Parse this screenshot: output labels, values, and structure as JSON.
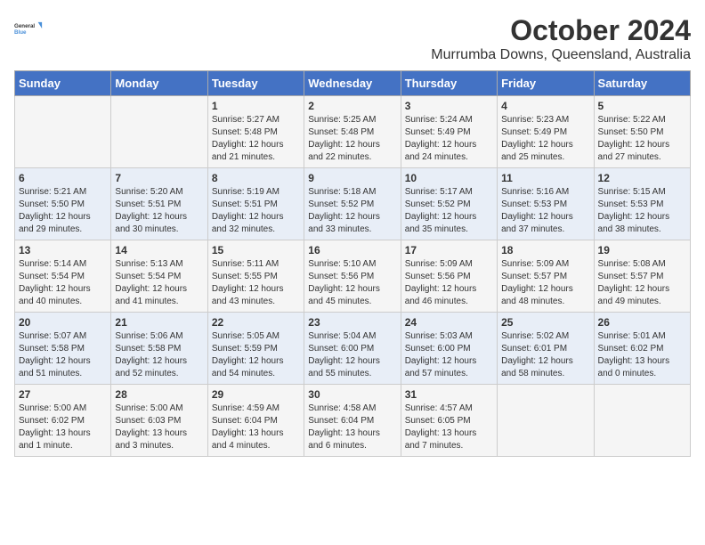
{
  "logo": {
    "line1": "General",
    "line2": "Blue"
  },
  "title": "October 2024",
  "location": "Murrumba Downs, Queensland, Australia",
  "days_of_week": [
    "Sunday",
    "Monday",
    "Tuesday",
    "Wednesday",
    "Thursday",
    "Friday",
    "Saturday"
  ],
  "weeks": [
    [
      {
        "day": "",
        "sunrise": "",
        "sunset": "",
        "daylight": ""
      },
      {
        "day": "",
        "sunrise": "",
        "sunset": "",
        "daylight": ""
      },
      {
        "day": "1",
        "sunrise": "Sunrise: 5:27 AM",
        "sunset": "Sunset: 5:48 PM",
        "daylight": "Daylight: 12 hours and 21 minutes."
      },
      {
        "day": "2",
        "sunrise": "Sunrise: 5:25 AM",
        "sunset": "Sunset: 5:48 PM",
        "daylight": "Daylight: 12 hours and 22 minutes."
      },
      {
        "day": "3",
        "sunrise": "Sunrise: 5:24 AM",
        "sunset": "Sunset: 5:49 PM",
        "daylight": "Daylight: 12 hours and 24 minutes."
      },
      {
        "day": "4",
        "sunrise": "Sunrise: 5:23 AM",
        "sunset": "Sunset: 5:49 PM",
        "daylight": "Daylight: 12 hours and 25 minutes."
      },
      {
        "day": "5",
        "sunrise": "Sunrise: 5:22 AM",
        "sunset": "Sunset: 5:50 PM",
        "daylight": "Daylight: 12 hours and 27 minutes."
      }
    ],
    [
      {
        "day": "6",
        "sunrise": "Sunrise: 5:21 AM",
        "sunset": "Sunset: 5:50 PM",
        "daylight": "Daylight: 12 hours and 29 minutes."
      },
      {
        "day": "7",
        "sunrise": "Sunrise: 5:20 AM",
        "sunset": "Sunset: 5:51 PM",
        "daylight": "Daylight: 12 hours and 30 minutes."
      },
      {
        "day": "8",
        "sunrise": "Sunrise: 5:19 AM",
        "sunset": "Sunset: 5:51 PM",
        "daylight": "Daylight: 12 hours and 32 minutes."
      },
      {
        "day": "9",
        "sunrise": "Sunrise: 5:18 AM",
        "sunset": "Sunset: 5:52 PM",
        "daylight": "Daylight: 12 hours and 33 minutes."
      },
      {
        "day": "10",
        "sunrise": "Sunrise: 5:17 AM",
        "sunset": "Sunset: 5:52 PM",
        "daylight": "Daylight: 12 hours and 35 minutes."
      },
      {
        "day": "11",
        "sunrise": "Sunrise: 5:16 AM",
        "sunset": "Sunset: 5:53 PM",
        "daylight": "Daylight: 12 hours and 37 minutes."
      },
      {
        "day": "12",
        "sunrise": "Sunrise: 5:15 AM",
        "sunset": "Sunset: 5:53 PM",
        "daylight": "Daylight: 12 hours and 38 minutes."
      }
    ],
    [
      {
        "day": "13",
        "sunrise": "Sunrise: 5:14 AM",
        "sunset": "Sunset: 5:54 PM",
        "daylight": "Daylight: 12 hours and 40 minutes."
      },
      {
        "day": "14",
        "sunrise": "Sunrise: 5:13 AM",
        "sunset": "Sunset: 5:54 PM",
        "daylight": "Daylight: 12 hours and 41 minutes."
      },
      {
        "day": "15",
        "sunrise": "Sunrise: 5:11 AM",
        "sunset": "Sunset: 5:55 PM",
        "daylight": "Daylight: 12 hours and 43 minutes."
      },
      {
        "day": "16",
        "sunrise": "Sunrise: 5:10 AM",
        "sunset": "Sunset: 5:56 PM",
        "daylight": "Daylight: 12 hours and 45 minutes."
      },
      {
        "day": "17",
        "sunrise": "Sunrise: 5:09 AM",
        "sunset": "Sunset: 5:56 PM",
        "daylight": "Daylight: 12 hours and 46 minutes."
      },
      {
        "day": "18",
        "sunrise": "Sunrise: 5:09 AM",
        "sunset": "Sunset: 5:57 PM",
        "daylight": "Daylight: 12 hours and 48 minutes."
      },
      {
        "day": "19",
        "sunrise": "Sunrise: 5:08 AM",
        "sunset": "Sunset: 5:57 PM",
        "daylight": "Daylight: 12 hours and 49 minutes."
      }
    ],
    [
      {
        "day": "20",
        "sunrise": "Sunrise: 5:07 AM",
        "sunset": "Sunset: 5:58 PM",
        "daylight": "Daylight: 12 hours and 51 minutes."
      },
      {
        "day": "21",
        "sunrise": "Sunrise: 5:06 AM",
        "sunset": "Sunset: 5:58 PM",
        "daylight": "Daylight: 12 hours and 52 minutes."
      },
      {
        "day": "22",
        "sunrise": "Sunrise: 5:05 AM",
        "sunset": "Sunset: 5:59 PM",
        "daylight": "Daylight: 12 hours and 54 minutes."
      },
      {
        "day": "23",
        "sunrise": "Sunrise: 5:04 AM",
        "sunset": "Sunset: 6:00 PM",
        "daylight": "Daylight: 12 hours and 55 minutes."
      },
      {
        "day": "24",
        "sunrise": "Sunrise: 5:03 AM",
        "sunset": "Sunset: 6:00 PM",
        "daylight": "Daylight: 12 hours and 57 minutes."
      },
      {
        "day": "25",
        "sunrise": "Sunrise: 5:02 AM",
        "sunset": "Sunset: 6:01 PM",
        "daylight": "Daylight: 12 hours and 58 minutes."
      },
      {
        "day": "26",
        "sunrise": "Sunrise: 5:01 AM",
        "sunset": "Sunset: 6:02 PM",
        "daylight": "Daylight: 13 hours and 0 minutes."
      }
    ],
    [
      {
        "day": "27",
        "sunrise": "Sunrise: 5:00 AM",
        "sunset": "Sunset: 6:02 PM",
        "daylight": "Daylight: 13 hours and 1 minute."
      },
      {
        "day": "28",
        "sunrise": "Sunrise: 5:00 AM",
        "sunset": "Sunset: 6:03 PM",
        "daylight": "Daylight: 13 hours and 3 minutes."
      },
      {
        "day": "29",
        "sunrise": "Sunrise: 4:59 AM",
        "sunset": "Sunset: 6:04 PM",
        "daylight": "Daylight: 13 hours and 4 minutes."
      },
      {
        "day": "30",
        "sunrise": "Sunrise: 4:58 AM",
        "sunset": "Sunset: 6:04 PM",
        "daylight": "Daylight: 13 hours and 6 minutes."
      },
      {
        "day": "31",
        "sunrise": "Sunrise: 4:57 AM",
        "sunset": "Sunset: 6:05 PM",
        "daylight": "Daylight: 13 hours and 7 minutes."
      },
      {
        "day": "",
        "sunrise": "",
        "sunset": "",
        "daylight": ""
      },
      {
        "day": "",
        "sunrise": "",
        "sunset": "",
        "daylight": ""
      }
    ]
  ]
}
